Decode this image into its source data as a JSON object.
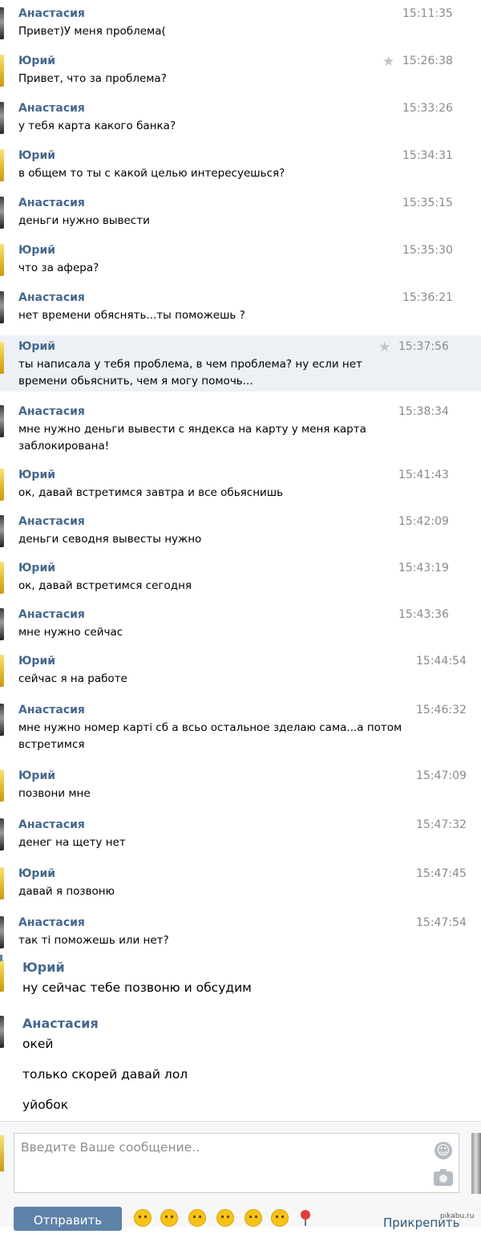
{
  "messages": [
    {
      "author": "Анастасия",
      "time": "15:11:35",
      "text": "Привет)У меня проблема(",
      "starred": false,
      "highlighted": false
    },
    {
      "author": "Юрий",
      "time": "15:26:38",
      "text": "Привет, что за проблема?",
      "starred": true,
      "highlighted": false
    },
    {
      "author": "Анастасия",
      "time": "15:33:26",
      "text": "у тебя карта какого банка?",
      "starred": false,
      "highlighted": false
    },
    {
      "author": "Юрий",
      "time": "15:34:31",
      "text": "в общем то ты с какой целью интересуешься?",
      "starred": false,
      "highlighted": false
    },
    {
      "author": "Анастасия",
      "time": "15:35:15",
      "text": "деньги нужно вывести",
      "starred": false,
      "highlighted": false
    },
    {
      "author": "Юрий",
      "time": "15:35:30",
      "text": "что за афера?",
      "starred": false,
      "highlighted": false
    },
    {
      "author": "Анастасия",
      "time": "15:36:21",
      "text": "нет времени обяснять...ты поможешь ?",
      "starred": false,
      "highlighted": false
    },
    {
      "author": "Юрий",
      "time": "15:37:56",
      "text": "ты написала у тебя проблема, в чем проблема? ну если нет\nвремени обьяснить, чем я могу помочь...",
      "starred": true,
      "highlighted": true
    },
    {
      "author": "Анастасия",
      "time": "15:38:34",
      "text": "мне нужно деньги вывести с яндекса на карту у меня карта\nзаблокирована!",
      "starred": false,
      "highlighted": false
    },
    {
      "author": "Юрий",
      "time": "15:41:43",
      "text": "ок, давай встретимся завтра и все обьяснишь",
      "starred": false,
      "highlighted": false
    },
    {
      "author": "Анастасия",
      "time": "15:42:09",
      "text": "деньги севодня вывесты нужно",
      "starred": false,
      "highlighted": false
    },
    {
      "author": "Юрий",
      "time": "15:43:19",
      "text": "ок, давай встретимся сегодня",
      "starred": false,
      "highlighted": false
    },
    {
      "author": "Анастасия",
      "time": "15:43:36",
      "text": "мне нужно сейчас",
      "starred": false,
      "highlighted": false
    },
    {
      "author": "Юрий",
      "time": "15:44:54",
      "text": "сейчас я на работе",
      "starred": false,
      "highlighted": false
    },
    {
      "author": "Анастасия",
      "time": "15:46:32",
      "text": "мне нужно номер карті сб а всьо остальное зделаю сама...а потом\nвстретимся",
      "starred": false,
      "highlighted": false
    },
    {
      "author": "Юрий",
      "time": "15:47:09",
      "text": "позвони мне",
      "starred": false,
      "highlighted": false
    },
    {
      "author": "Анастасия",
      "time": "15:47:32",
      "text": "денег на щету нет",
      "starred": false,
      "highlighted": false
    },
    {
      "author": "Юрий",
      "time": "15:47:45",
      "text": "давай я позвоню",
      "starred": false,
      "highlighted": false
    },
    {
      "author": "Анастасия",
      "time": "15:47:54",
      "text": "так ті поможешь или нет?",
      "starred": false,
      "highlighted": false
    },
    {
      "author": "Юрий",
      "time": "",
      "text": "ну сейчас тебе позвоню и обсудим",
      "starred": false,
      "highlighted": false
    },
    {
      "author": "Анастасия",
      "time": "",
      "text": "окей\n\nтолько скорей давай лол\n\nуйобок",
      "starred": false,
      "highlighted": false
    }
  ],
  "composer": {
    "placeholder": "Введите Ваше сообщение..",
    "send_label": "Отправить",
    "attach_label": "Прикрепить",
    "smile_icon": "smile-icon",
    "camera_icon": "camera-icon",
    "emoji_count": 7
  },
  "watermark": "pikabu.ru",
  "colors": {
    "author_name": "#45688e",
    "timestamp": "#8a8a8a",
    "highlight_row": "#edf1f5",
    "send_button": "#5e82a8",
    "link": "#2b587a"
  }
}
